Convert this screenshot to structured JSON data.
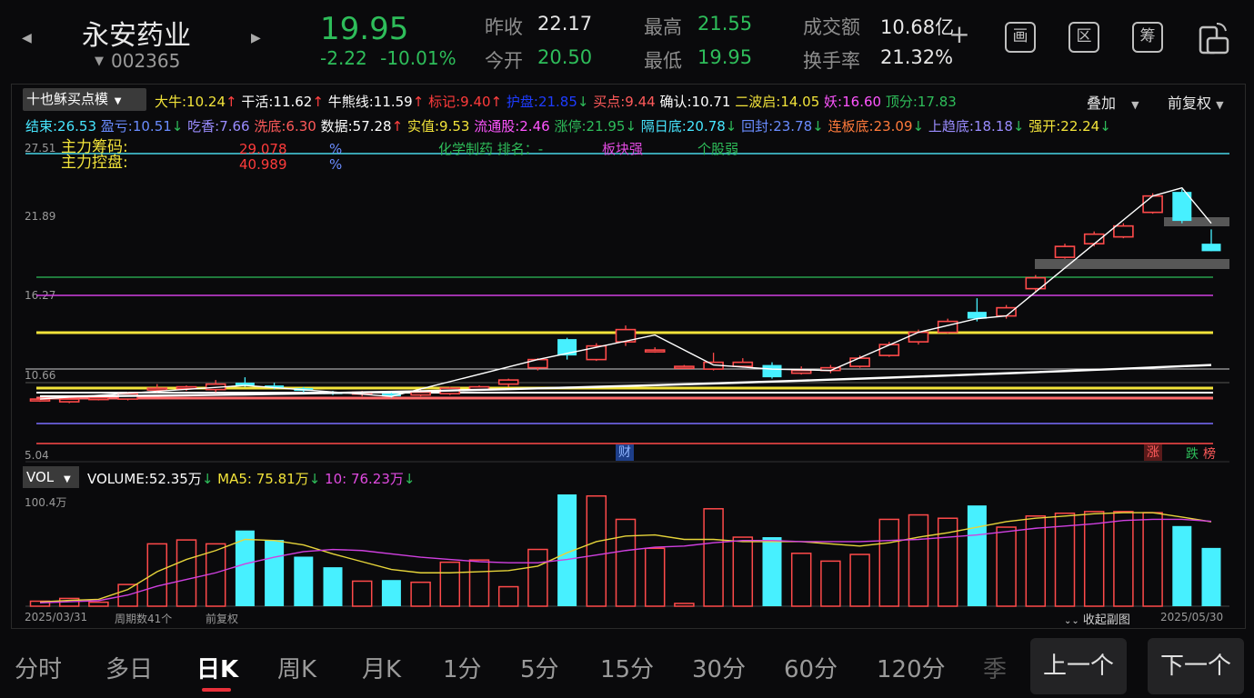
{
  "header": {
    "stock_name": "永安药业",
    "stock_code": "002365",
    "price": "19.95",
    "change": "-2.22",
    "change_pct": "-10.01%",
    "stats": [
      {
        "label": "昨收",
        "value": "22.17",
        "color": "white"
      },
      {
        "label": "今开",
        "value": "20.50",
        "color": "green"
      },
      {
        "label": "最高",
        "value": "21.55",
        "color": "green"
      },
      {
        "label": "最低",
        "value": "19.95",
        "color": "green"
      },
      {
        "label": "成交额",
        "value": "10.68亿",
        "color": "white"
      },
      {
        "label": "换手率",
        "value": "21.32%",
        "color": "white"
      }
    ],
    "icons": [
      "add-watchlist-icon",
      "draw-icon",
      "range-icon",
      "chip-icon",
      "landscape-icon"
    ],
    "icon_glyphs": [
      "+",
      "画",
      "区",
      "筹",
      ""
    ]
  },
  "indicator_bar": {
    "selector_label": "十也稣买点模",
    "overlay_label": "叠加",
    "adjust_label": "前复权",
    "row1": [
      {
        "text": "大牛:10.24",
        "arrow": "↑",
        "color": "#f2e33a",
        "arrow_color": "#ff4040"
      },
      {
        "text": "干活:11.62",
        "arrow": "↑",
        "color": "#ffffff",
        "arrow_color": "#ff4040"
      },
      {
        "text": "牛熊线:11.59",
        "arrow": "↑",
        "color": "#ffffff",
        "arrow_color": "#ff4040"
      },
      {
        "text": "标记:9.40",
        "arrow": "↑",
        "color": "#ff3b3b",
        "arrow_color": "#ff4040"
      },
      {
        "text": "护盘:21.85",
        "arrow": "↓",
        "color": "#1e3cff",
        "arrow_color": "#2ebd5a"
      },
      {
        "text": "买点:9.44",
        "arrow": "",
        "color": "#ff5a5a",
        "arrow_color": ""
      },
      {
        "text": "确认:10.71",
        "arrow": "",
        "color": "#ffffff",
        "arrow_color": ""
      },
      {
        "text": "二波启:14.05",
        "arrow": "",
        "color": "#f2e33a",
        "arrow_color": ""
      },
      {
        "text": "妖:16.60",
        "arrow": "",
        "color": "#ff55ff",
        "arrow_color": ""
      },
      {
        "text": "顶分:17.83",
        "arrow": "",
        "color": "#2ebd5a",
        "arrow_color": ""
      }
    ],
    "row2": [
      {
        "text": "结束:26.53",
        "arrow": "",
        "color": "#47e6ff",
        "arrow_color": ""
      },
      {
        "text": "盈亏:10.51",
        "arrow": "↓",
        "color": "#6a8cff",
        "arrow_color": "#2ebd5a"
      },
      {
        "text": "吃香:7.66",
        "arrow": "",
        "color": "#9a8cff",
        "arrow_color": ""
      },
      {
        "text": "洗底:6.30",
        "arrow": "",
        "color": "#ff5a5a",
        "arrow_color": ""
      },
      {
        "text": "数据:57.28",
        "arrow": "↑",
        "color": "#ffffff",
        "arrow_color": "#ff4040"
      },
      {
        "text": "实值:9.53",
        "arrow": "",
        "color": "#f2e33a",
        "arrow_color": ""
      },
      {
        "text": "流通股:2.46",
        "arrow": "",
        "color": "#ff55ff",
        "arrow_color": ""
      },
      {
        "text": "涨停:21.95",
        "arrow": "↓",
        "color": "#2ebd5a",
        "arrow_color": "#2ebd5a"
      },
      {
        "text": "隔日底:20.78",
        "arrow": "↓",
        "color": "#47e6ff",
        "arrow_color": "#2ebd5a"
      },
      {
        "text": "回封:23.78",
        "arrow": "↓",
        "color": "#6a8cff",
        "arrow_color": "#2ebd5a"
      },
      {
        "text": "连板底:23.09",
        "arrow": "↓",
        "color": "#ff7a3b",
        "arrow_color": "#2ebd5a"
      },
      {
        "text": "上趋底:18.18",
        "arrow": "↓",
        "color": "#9a8cff",
        "arrow_color": "#2ebd5a"
      },
      {
        "text": "强开:22.24",
        "arrow": "↓",
        "color": "#f2e33a",
        "arrow_color": "#2ebd5a"
      }
    ]
  },
  "main_chart": {
    "y_ticks": [
      "27.51",
      "21.89",
      "16.27",
      "10.66",
      "5.04"
    ],
    "info_lines": [
      {
        "label": "主力筹码:",
        "value": "29.078",
        "unit": "%"
      },
      {
        "label": "主力控盘:",
        "value": "40.989",
        "unit": "%"
      }
    ],
    "sector_text": "化学制药 排名：-",
    "sector_strong": "板块强",
    "stock_weak": "个股弱",
    "bottom_markers": {
      "finance": "财",
      "rise": "涨",
      "fall": "跌",
      "rank": "榜"
    }
  },
  "volume_panel": {
    "selector_label": "VOL",
    "legend": [
      {
        "text": "VOLUME:52.35万",
        "arrow": "↓",
        "color": "#ffffff"
      },
      {
        "text": "MA5: 75.81万",
        "arrow": "↓",
        "color": "#f2e33a"
      },
      {
        "text": "10: 76.23万",
        "arrow": "↓",
        "color": "#e04ae0"
      }
    ],
    "max_label": "100.4万",
    "start_date": "2025/03/31",
    "period_count": "周期数41个",
    "adjust": "前复权",
    "collapse_label": "收起副图",
    "end_date": "2025/05/30"
  },
  "chart_data": {
    "type": "candlestick",
    "y_range": [
      5.04,
      27.51
    ],
    "candles": [
      {
        "o": 9.0,
        "c": 9.1,
        "h": 9.2,
        "l": 8.9
      },
      {
        "o": 8.9,
        "c": 9.1,
        "h": 9.2,
        "l": 8.8
      },
      {
        "o": 9.1,
        "c": 9.2,
        "h": 9.3,
        "l": 9.0
      },
      {
        "o": 9.1,
        "c": 9.5,
        "h": 9.6,
        "l": 9.0
      },
      {
        "o": 9.8,
        "c": 9.9,
        "h": 10.2,
        "l": 9.6
      },
      {
        "o": 9.9,
        "c": 10.0,
        "h": 10.1,
        "l": 9.7
      },
      {
        "o": 9.8,
        "c": 10.2,
        "h": 10.5,
        "l": 9.6
      },
      {
        "o": 10.3,
        "c": 10.1,
        "h": 10.7,
        "l": 10.0
      },
      {
        "o": 10.1,
        "c": 9.95,
        "h": 10.3,
        "l": 9.8
      },
      {
        "o": 9.9,
        "c": 9.7,
        "h": 10.0,
        "l": 9.6
      },
      {
        "o": 9.6,
        "c": 9.5,
        "h": 9.7,
        "l": 9.4
      },
      {
        "o": 9.5,
        "c": 9.6,
        "h": 9.7,
        "l": 9.3
      },
      {
        "o": 9.5,
        "c": 9.3,
        "h": 9.6,
        "l": 9.2
      },
      {
        "o": 9.4,
        "c": 9.6,
        "h": 9.8,
        "l": 9.3
      },
      {
        "o": 9.5,
        "c": 9.9,
        "h": 10.0,
        "l": 9.4
      },
      {
        "o": 9.8,
        "c": 10.0,
        "h": 10.1,
        "l": 9.7
      },
      {
        "o": 10.2,
        "c": 10.5,
        "h": 10.6,
        "l": 10.0
      },
      {
        "o": 11.4,
        "c": 12.0,
        "h": 12.1,
        "l": 11.2
      },
      {
        "o": 13.5,
        "c": 12.3,
        "h": 13.6,
        "l": 12.0
      },
      {
        "o": 12.0,
        "c": 13.0,
        "h": 13.2,
        "l": 11.9
      },
      {
        "o": 13.3,
        "c": 14.2,
        "h": 14.5,
        "l": 13.0
      },
      {
        "o": 12.6,
        "c": 12.7,
        "h": 12.9,
        "l": 12.5
      },
      {
        "o": 11.5,
        "c": 11.5,
        "h": 11.6,
        "l": 11.4
      },
      {
        "o": 11.3,
        "c": 11.8,
        "h": 12.5,
        "l": 11.2
      },
      {
        "o": 11.5,
        "c": 11.8,
        "h": 12.1,
        "l": 11.4
      },
      {
        "o": 11.6,
        "c": 10.7,
        "h": 11.8,
        "l": 10.6
      },
      {
        "o": 11.0,
        "c": 11.2,
        "h": 11.5,
        "l": 10.9
      },
      {
        "o": 11.2,
        "c": 11.4,
        "h": 11.6,
        "l": 11.0
      },
      {
        "o": 11.5,
        "c": 12.1,
        "h": 12.3,
        "l": 11.4
      },
      {
        "o": 12.3,
        "c": 13.1,
        "h": 13.3,
        "l": 12.2
      },
      {
        "o": 13.3,
        "c": 14.0,
        "h": 14.2,
        "l": 13.1
      },
      {
        "o": 14.0,
        "c": 14.8,
        "h": 15.0,
        "l": 13.9
      },
      {
        "o": 15.5,
        "c": 15.0,
        "h": 16.5,
        "l": 14.8
      },
      {
        "o": 15.2,
        "c": 15.8,
        "h": 16.0,
        "l": 15.0
      },
      {
        "o": 17.2,
        "c": 18.0,
        "h": 18.2,
        "l": 17.0
      },
      {
        "o": 19.5,
        "c": 20.3,
        "h": 20.5,
        "l": 19.4
      },
      {
        "o": 20.5,
        "c": 21.2,
        "h": 21.4,
        "l": 20.3
      },
      {
        "o": 21.0,
        "c": 21.8,
        "h": 22.0,
        "l": 20.9
      },
      {
        "o": 22.8,
        "c": 24.0,
        "h": 24.2,
        "l": 22.7
      },
      {
        "o": 24.3,
        "c": 22.17,
        "h": 24.5,
        "l": 22.0
      },
      {
        "o": 20.5,
        "c": 19.95,
        "h": 21.55,
        "l": 19.95
      }
    ],
    "volumes": [
      4.5,
      7.0,
      3.6,
      19.5,
      56.0,
      59.5,
      56.0,
      68.0,
      59.5,
      44.5,
      35.0,
      22.5,
      23.5,
      21.5,
      39.5,
      41.5,
      17.5,
      51.0,
      100.4,
      99.0,
      78.0,
      52.0,
      2.5,
      87.5,
      62.0,
      62.0,
      47.5,
      40.5,
      46.5,
      78.0,
      82.0,
      79.0,
      90.5,
      71.0,
      81.0,
      83.5,
      85.0,
      85.0,
      84.0,
      72.0,
      52.35
    ],
    "ma5": [
      3.8,
      5.2,
      6.2,
      15.0,
      31.0,
      42.0,
      50.0,
      60.0,
      59.0,
      55.0,
      47.0,
      40.0,
      33.0,
      30.0,
      30.0,
      31.0,
      32.0,
      36.0,
      48.0,
      58.0,
      63.0,
      64.0,
      60.0,
      60.0,
      58.0,
      58.0,
      58.0,
      56.0,
      54.0,
      57.0,
      62.0,
      66.0,
      71.0,
      76.0,
      79.0,
      81.0,
      83.0,
      84.0,
      84.0,
      80.0,
      75.81
    ],
    "ma10": [
      3.0,
      4.0,
      5.0,
      10.0,
      18.0,
      24.0,
      30.0,
      38.0,
      44.0,
      49.0,
      51.0,
      50.0,
      47.0,
      44.0,
      42.0,
      40.0,
      39.0,
      39.0,
      42.0,
      46.0,
      50.0,
      53.0,
      54.0,
      57.0,
      59.0,
      59.0,
      58.0,
      58.0,
      58.0,
      59.0,
      60.0,
      62.0,
      64.0,
      67.0,
      70.0,
      72.0,
      74.0,
      77.0,
      78.0,
      78.0,
      76.23
    ]
  }
}
